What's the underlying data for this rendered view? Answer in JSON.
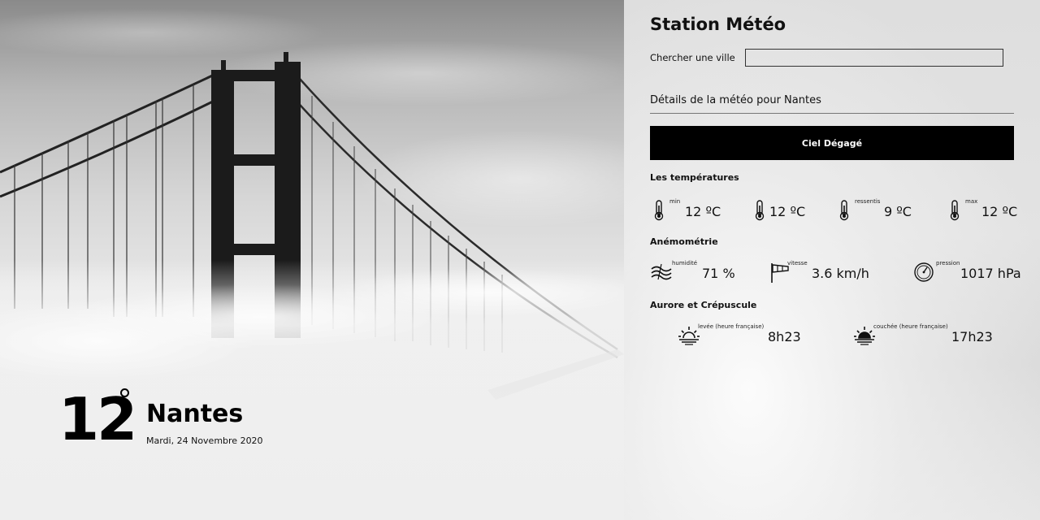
{
  "hero": {
    "temperature": "12",
    "city": "Nantes",
    "date": "Mardi, 24 Novembre 2020"
  },
  "panel": {
    "title": "Station Météo",
    "search": {
      "label": "Chercher une ville",
      "value": ""
    },
    "details_heading": "Détails de la météo pour Nantes",
    "sky": "Ciel Dégagé",
    "temperatures": {
      "title": "Les températures",
      "items": [
        {
          "tag": "min",
          "value": "12 ºC",
          "icon": "thermometer-icon"
        },
        {
          "tag": "",
          "value": "12 ºC",
          "icon": "thermometer-icon"
        },
        {
          "tag": "ressentis",
          "value": "9 ºC",
          "icon": "thermometer-icon"
        },
        {
          "tag": "max",
          "value": "12 ºC",
          "icon": "thermometer-icon"
        }
      ]
    },
    "anemometry": {
      "title": "Anémométrie",
      "items": [
        {
          "tag": "humidité",
          "value": "71 %",
          "icon": "humidity-icon"
        },
        {
          "tag": "vitesse",
          "value": "3.6 km/h",
          "icon": "windsock-icon"
        },
        {
          "tag": "pression",
          "value": "1017 hPa",
          "icon": "barometer-icon"
        }
      ]
    },
    "sun": {
      "title": "Aurore et Crépuscule",
      "items": [
        {
          "tag": "levée (heure française)",
          "value": "8h23",
          "icon": "sunrise-icon"
        },
        {
          "tag": "couchée (heure française)",
          "value": "17h23",
          "icon": "sunset-icon"
        }
      ]
    }
  },
  "colors": {
    "accent_bar": "#000000",
    "panel_bg": "#e0e0e0",
    "text": "#111111"
  }
}
